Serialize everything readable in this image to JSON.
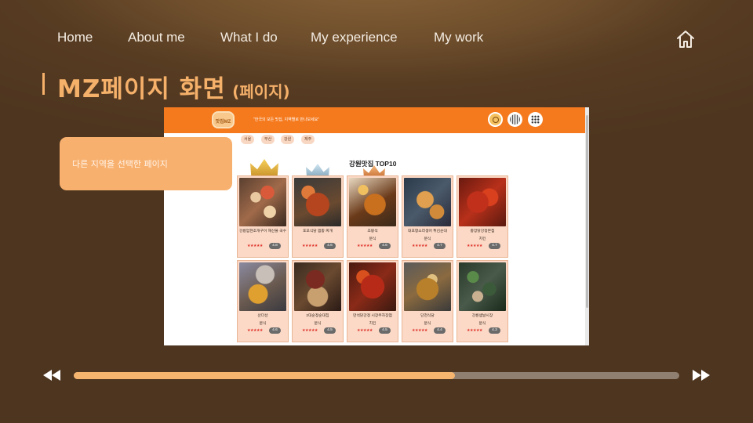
{
  "nav": {
    "items": [
      "Home",
      "About me",
      "What I do",
      "My experience",
      "My work"
    ],
    "home_icon": "home-icon"
  },
  "title": {
    "main": "MZ페이지 화면",
    "sub": "(페이지)"
  },
  "callout": {
    "text": "다른 지역을 선택한 페이지"
  },
  "screenshot": {
    "logo_text": "맛집MZ",
    "slogan": "\"한국의 모든 맛집, 지역별로 만나보세요\"",
    "header_icons": [
      "search-icon",
      "globe-icon",
      "grid-menu-icon"
    ],
    "regions": [
      "서울",
      "부산",
      "강원",
      "제주"
    ],
    "list_title": "강원맛집 TOP10",
    "cards": [
      {
        "name": "강릉엄현조개구이 해산물 국수",
        "category": "",
        "stars": "★★★★★",
        "rating": "4.8"
      },
      {
        "name": "포포식당 짬뽕 찌개",
        "category": "",
        "stars": "★★★★★",
        "rating": "4.6"
      },
      {
        "name": "조봉석",
        "category": "분식",
        "stars": "★★★★★",
        "rating": "4.6"
      },
      {
        "name": "대포항소라생어 튀김순대",
        "category": "분식",
        "stars": "★★★★★",
        "rating": "4.7"
      },
      {
        "name": "중앙닭강정본점",
        "category": "치킨",
        "stars": "★★★★★",
        "rating": "4.7"
      },
      {
        "name": "산다선",
        "category": "분식",
        "stars": "★★★★★",
        "rating": "4.6"
      },
      {
        "name": "2대순정순대집",
        "category": "분식",
        "stars": "★★★★★",
        "rating": "4.5"
      },
      {
        "name": "만석닭강정 시장주차장점",
        "category": "치킨",
        "stars": "★★★★★",
        "rating": "4.5"
      },
      {
        "name": "단천식당",
        "category": "분식",
        "stars": "★★★★★",
        "rating": "4.4"
      },
      {
        "name": "강릉샘날시장",
        "category": "분식",
        "stars": "★★★★★",
        "rating": "4.3"
      }
    ]
  },
  "player": {
    "progress": 0.63,
    "rewind_icon": "rewind-icon",
    "forward_icon": "fast-forward-icon"
  },
  "colors": {
    "accent": "#f5b06a",
    "header_orange": "#f57a1e",
    "card_bg": "#fbd9c6",
    "track": "#8f7f70"
  }
}
